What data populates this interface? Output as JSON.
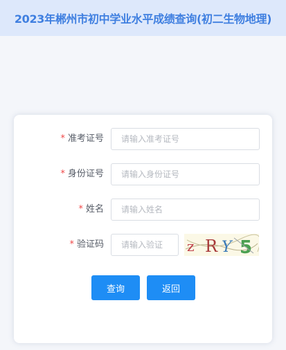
{
  "header": {
    "title": "2023年郴州市初中学业水平成绩查询(初二生物地理)"
  },
  "form": {
    "required_mark": "*",
    "fields": [
      {
        "label": "准考证号",
        "placeholder": "请输入准考证号"
      },
      {
        "label": "身份证号",
        "placeholder": "请输入身份证号"
      },
      {
        "label": "姓名",
        "placeholder": "请输入姓名"
      },
      {
        "label": "验证码",
        "placeholder": "请输入验证"
      }
    ],
    "captcha": {
      "chars": [
        "z",
        "R",
        "Y",
        "5"
      ],
      "colors": [
        "#c0404a",
        "#a83a3a",
        "#3a7ab8",
        "#4aa050"
      ],
      "background": "#fbf8e6"
    },
    "buttons": {
      "query": "查询",
      "back": "返回"
    }
  },
  "colors": {
    "header_bg": "#dde8fb",
    "header_text": "#3f7fe0",
    "primary": "#1e8df5",
    "required": "#f04848"
  }
}
